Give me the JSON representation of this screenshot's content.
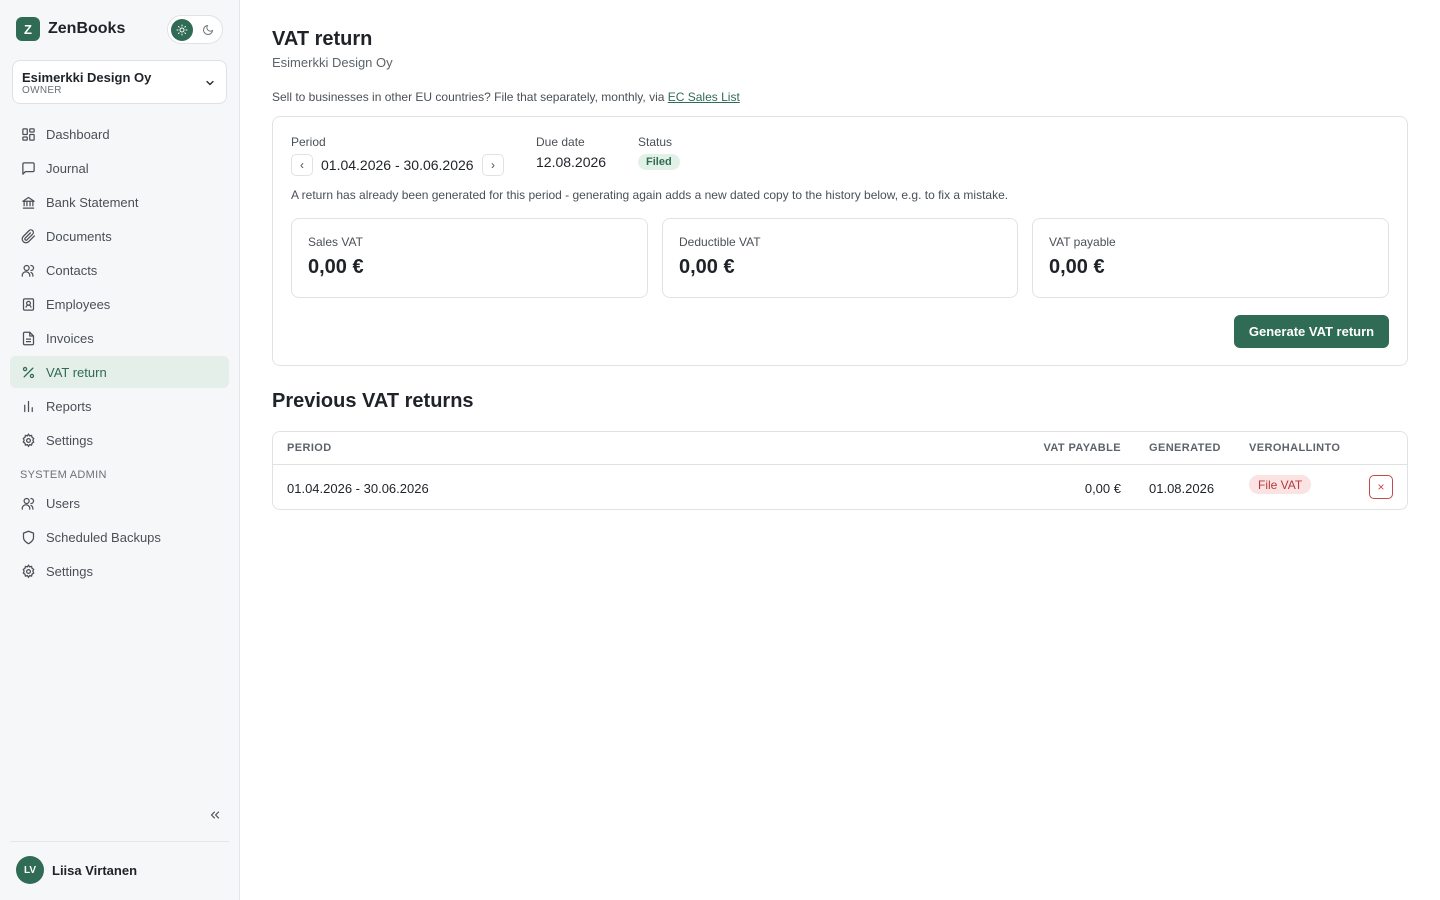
{
  "app": {
    "logo_letter": "Z",
    "name": "ZenBooks"
  },
  "org": {
    "name": "Esimerkki Design Oy",
    "role": "OWNER"
  },
  "nav": [
    {
      "label": "Dashboard",
      "icon": "dashboard-icon"
    },
    {
      "label": "Journal",
      "icon": "journal-icon"
    },
    {
      "label": "Bank Statement",
      "icon": "bank-icon"
    },
    {
      "label": "Documents",
      "icon": "paperclip-icon"
    },
    {
      "label": "Contacts",
      "icon": "contacts-icon"
    },
    {
      "label": "Employees",
      "icon": "employee-badge-icon"
    },
    {
      "label": "Invoices",
      "icon": "invoice-icon"
    },
    {
      "label": "VAT return",
      "icon": "percent-icon",
      "active": true
    },
    {
      "label": "Reports",
      "icon": "bar-chart-icon"
    },
    {
      "label": "Settings",
      "icon": "gear-icon"
    }
  ],
  "admin": {
    "section_label": "SYSTEM ADMIN",
    "items": [
      {
        "label": "Users",
        "icon": "users-icon"
      },
      {
        "label": "Scheduled Backups",
        "icon": "shield-icon"
      },
      {
        "label": "Settings",
        "icon": "gear-icon"
      }
    ]
  },
  "user": {
    "initials": "LV",
    "name": "Liisa Virtanen"
  },
  "page": {
    "title": "VAT return",
    "subtitle": "Esimerkki Design Oy",
    "notice_text": "Sell to businesses in other EU countries? File that separately, monthly, via ",
    "notice_link": "EC Sales List"
  },
  "current": {
    "period_label": "Period",
    "period_value": "01.04.2026 - 30.06.2026",
    "prev_symbol": "‹",
    "next_symbol": "›",
    "due_label": "Due date",
    "due_value": "12.08.2026",
    "status_label": "Status",
    "status_value": "Filed",
    "hint": "A return has already been generated for this period - generating again adds a new dated copy to the history below, e.g. to fix a mistake.",
    "stats": [
      {
        "label": "Sales VAT",
        "value": "0,00 €"
      },
      {
        "label": "Deductible VAT",
        "value": "0,00 €"
      },
      {
        "label": "VAT payable",
        "value": "0,00 €"
      }
    ],
    "generate_label": "Generate VAT return"
  },
  "history": {
    "title": "Previous VAT returns",
    "columns": [
      "PERIOD",
      "VAT PAYABLE",
      "GENERATED",
      "VEROHALLINTO"
    ],
    "rows": [
      {
        "period": "01.04.2026 - 30.06.2026",
        "vat_payable": "0,00 €",
        "generated": "01.08.2026",
        "action": "File VAT",
        "delete_symbol": "×"
      }
    ]
  },
  "colors": {
    "accent": "#2f6b55",
    "accent_light": "#e3efe8",
    "danger": "#c24a4a"
  }
}
